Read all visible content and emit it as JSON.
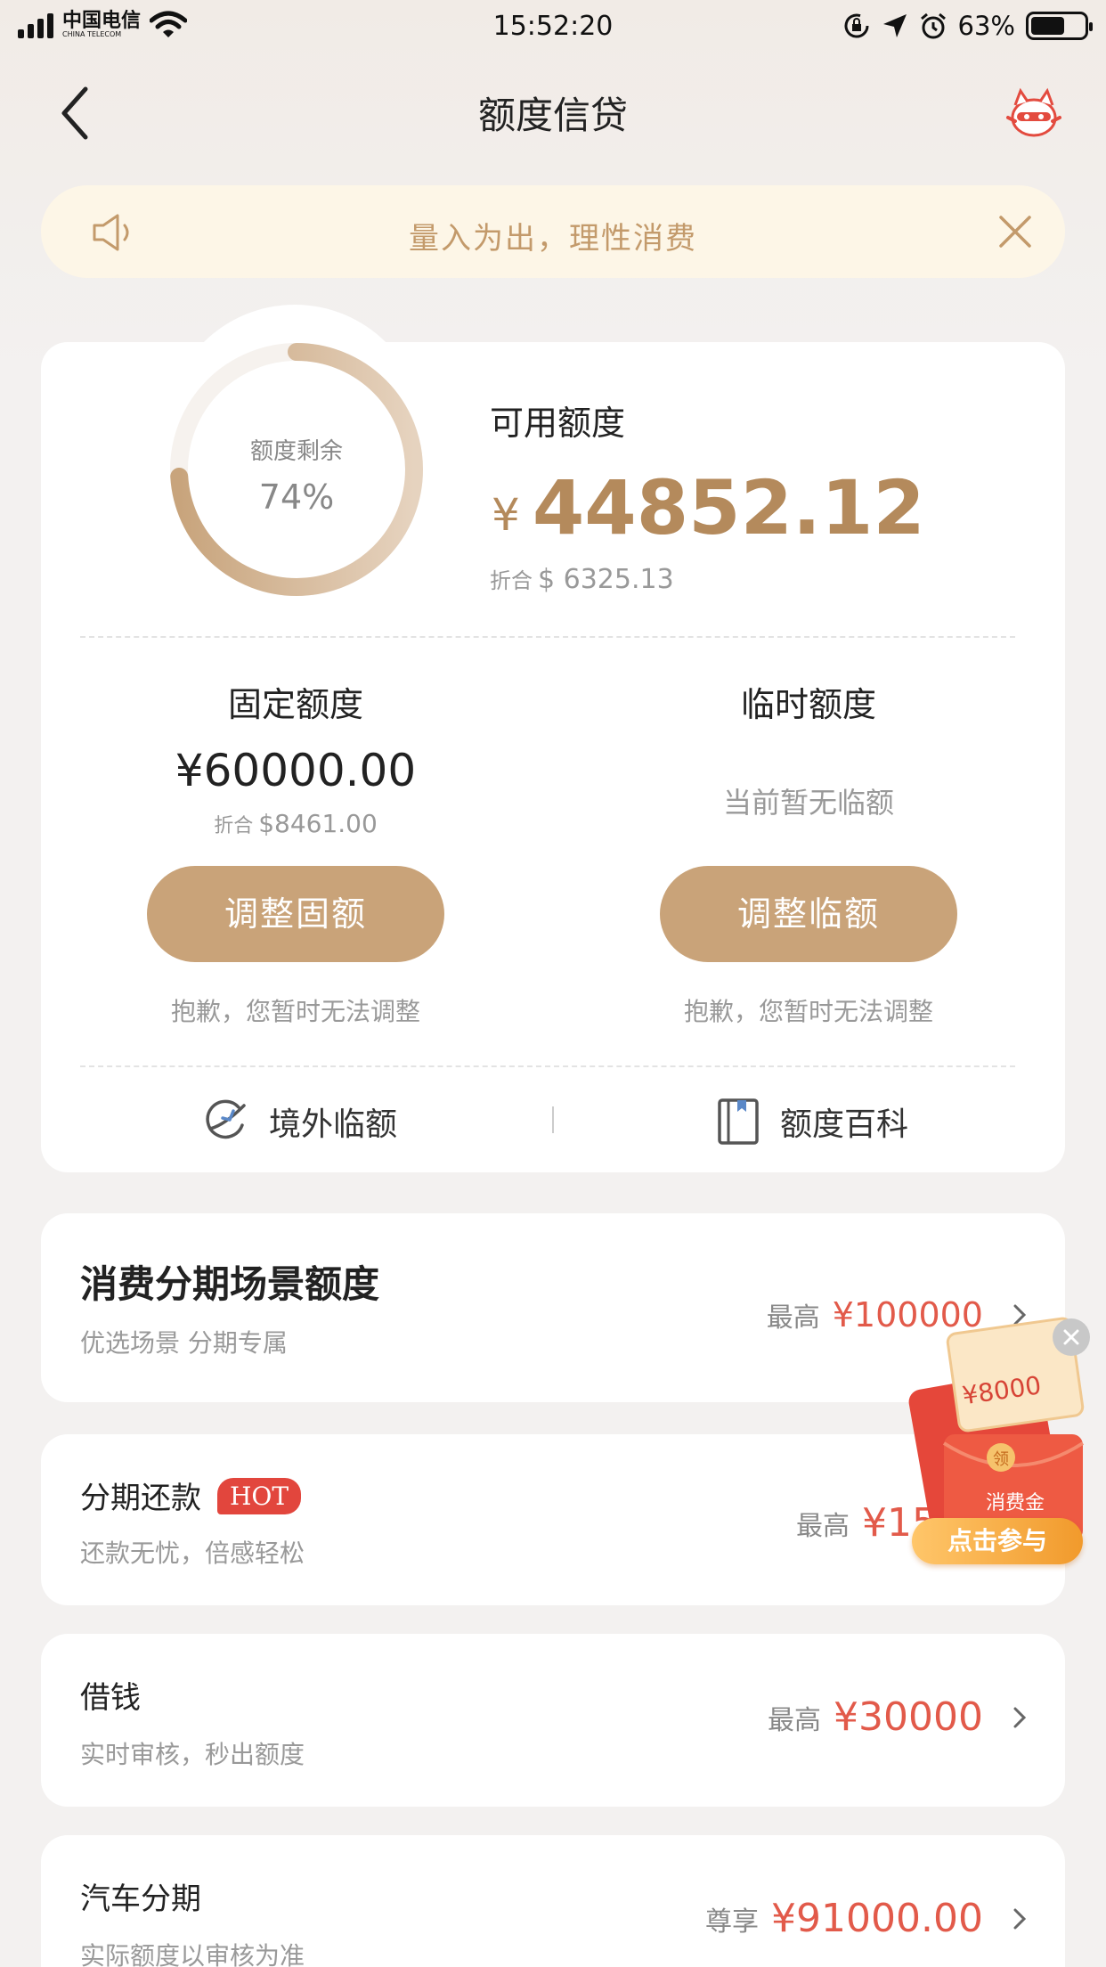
{
  "status_bar": {
    "carrier": "中国电信",
    "carrier_en": "CHINA TELECOM",
    "time": "15:52:20",
    "battery": "63%",
    "battery_level": 0.63
  },
  "nav": {
    "title": "额度信贷",
    "back_icon": "chevron-left-icon",
    "mascot_icon": "mascot-icon"
  },
  "notice": {
    "text": "量入为出，理性消费",
    "speaker_icon": "speaker-icon",
    "close_icon": "close-icon"
  },
  "credit": {
    "ring_label": "额度剩余",
    "ring_percent": "74%",
    "ring_value": 0.74,
    "available_label": "可用额度",
    "currency_symbol": "¥",
    "available_amount": "44852.12",
    "conv_prefix": "折合",
    "available_usd": "$ 6325.13",
    "fixed": {
      "title": "固定额度",
      "amount": "¥60000.00",
      "conv_prefix": "折合",
      "usd": "$8461.00",
      "button": "调整固额",
      "note": "抱歉，您暂时无法调整"
    },
    "temp": {
      "title": "临时额度",
      "status": "当前暂无临额",
      "button": "调整临额",
      "note": "抱歉，您暂时无法调整"
    },
    "links": {
      "overseas": "境外临额",
      "wiki": "额度百科"
    }
  },
  "list": [
    {
      "title": "消费分期场景额度",
      "subtitle": "优选场景 分期专属",
      "prefix": "最高",
      "amount": "¥100000"
    },
    {
      "title": "分期还款",
      "badge": "HOT",
      "subtitle": "还款无忧，倍感轻松",
      "prefix": "最高",
      "amount": "¥15147"
    },
    {
      "title": "借钱",
      "subtitle": "实时审核，秒出额度",
      "prefix": "最高",
      "amount": "¥30000"
    },
    {
      "title": "汽车分期",
      "subtitle": "实际额度以审核为准",
      "prefix": "尊享",
      "amount": "¥91000.00"
    }
  ],
  "promo": {
    "amount": "¥8000",
    "seal": "领",
    "envelope_label": "消费金",
    "button": "点击参与"
  },
  "colors": {
    "accent": "#c9a379",
    "amount_gold": "#b48a5c",
    "amount_red": "#e25a4a",
    "notice_bg": "#fdf6e7"
  }
}
